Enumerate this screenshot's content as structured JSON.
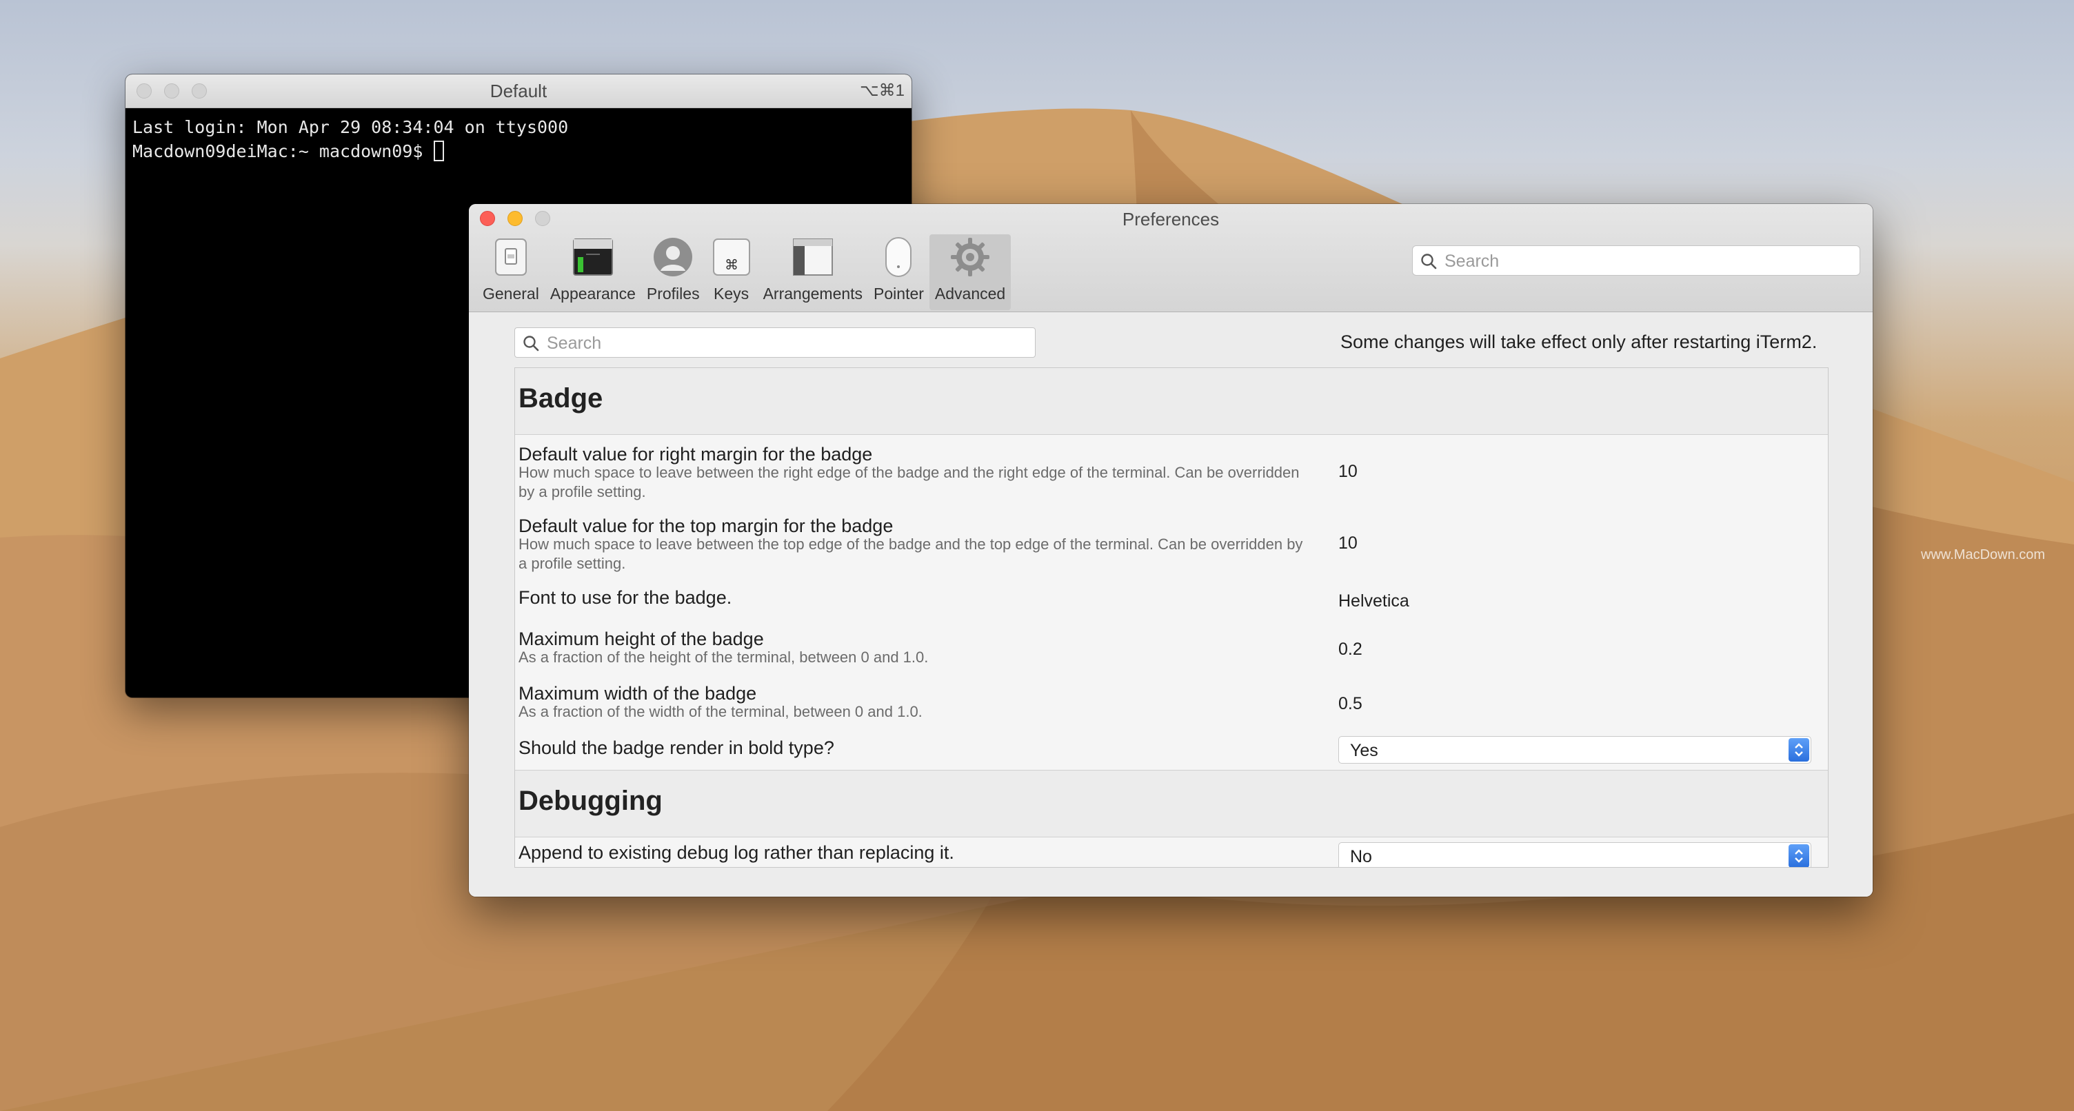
{
  "terminal": {
    "title": "Default",
    "shortcut": "⌥⌘1",
    "lines": [
      "Last login: Mon Apr 29 08:34:04 on ttys000",
      "Macdown09deiMac:~ macdown09$ "
    ]
  },
  "preferences": {
    "title": "Preferences",
    "toolbar": [
      {
        "label": "General",
        "icon": "switch-icon"
      },
      {
        "label": "Appearance",
        "icon": "window-appearance-icon"
      },
      {
        "label": "Profiles",
        "icon": "profile-avatar-icon"
      },
      {
        "label": "Keys",
        "icon": "command-key-icon"
      },
      {
        "label": "Arrangements",
        "icon": "arrangements-icon"
      },
      {
        "label": "Pointer",
        "icon": "mouse-icon"
      },
      {
        "label": "Advanced",
        "icon": "gear-icon",
        "selected": true
      }
    ],
    "header_search_placeholder": "Search",
    "advanced": {
      "search_placeholder": "Search",
      "restart_note": "Some changes will take effect only after restarting iTerm2.",
      "sections": [
        {
          "heading": "Badge",
          "rows": [
            {
              "title": "Default value for right margin for the badge",
              "desc": "How much space to leave between the right edge of the badge and the right edge of the terminal. Can be overridden by a profile setting.",
              "value": "10"
            },
            {
              "title": "Default value for the top margin for the badge",
              "desc": "How much space to leave between the top edge of the badge and the top edge of the terminal. Can be overridden by a profile setting.",
              "value": "10"
            },
            {
              "title": "Font to use for the badge.",
              "value": "Helvetica"
            },
            {
              "title": "Maximum height of the badge",
              "desc": "As a fraction of the height of the terminal, between 0 and 1.0.",
              "value": "0.2"
            },
            {
              "title": "Maximum width of the badge",
              "desc": "As a fraction of the width of the terminal, between 0 and 1.0.",
              "value": "0.5"
            },
            {
              "title": "Should the badge render in bold type?",
              "select": "Yes"
            }
          ]
        },
        {
          "heading": "Debugging",
          "rows": [
            {
              "title": "Append to existing debug log rather than replacing it.",
              "select": "No"
            }
          ]
        }
      ]
    }
  },
  "watermark": "www.MacDown.com",
  "colors": {
    "close": "#fc5f57",
    "minimize": "#fdbb2e",
    "select_stepper": "#2a6fdd"
  }
}
